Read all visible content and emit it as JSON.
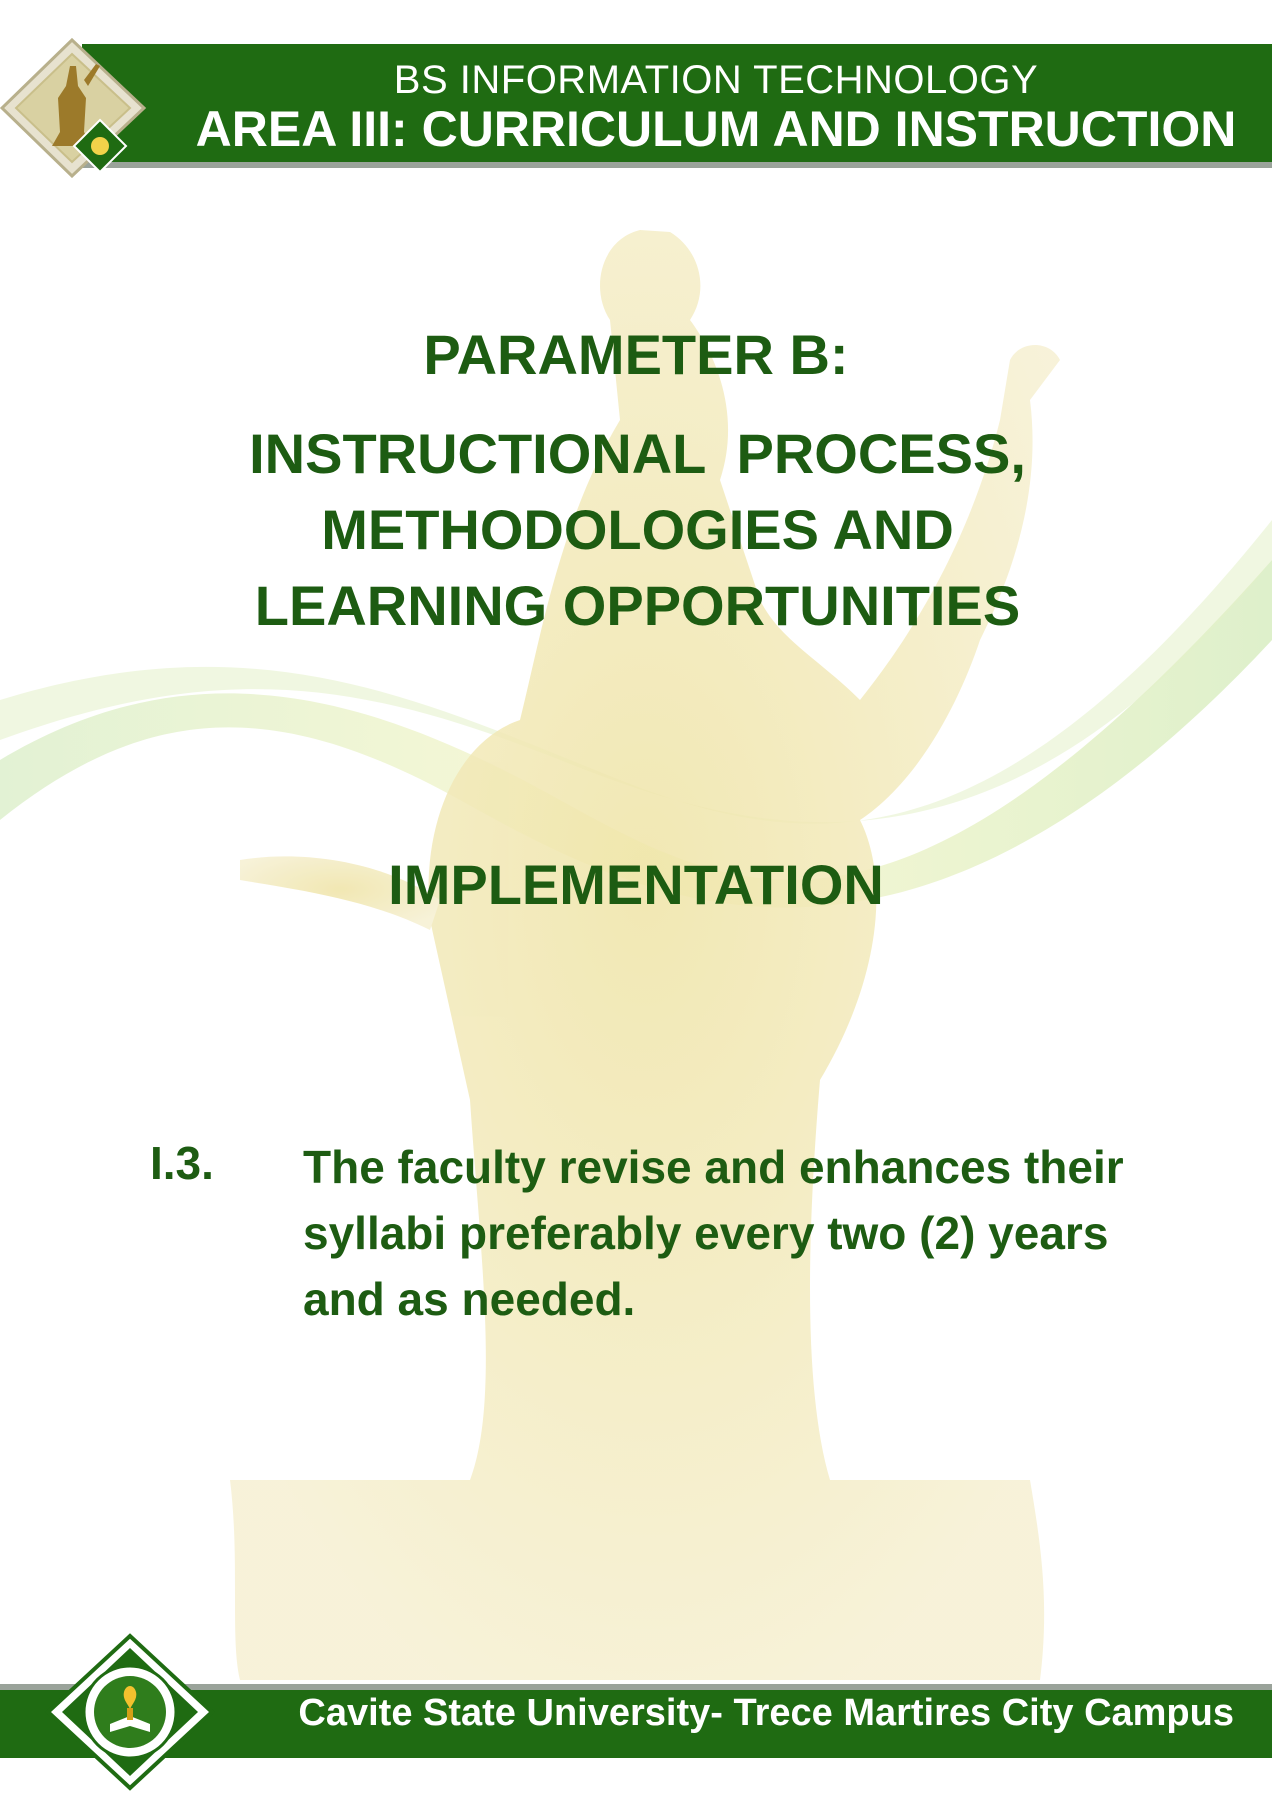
{
  "header": {
    "program": "BS INFORMATION TECHNOLOGY",
    "area": "AREA III: CURRICULUM AND INSTRUCTION"
  },
  "content": {
    "parameter_title": "PARAMETER B:",
    "parameter_subtitle": "INSTRUCTIONAL  PROCESS,\nMETHODOLOGIES AND\nLEARNING OPPORTUNITIES",
    "section": "IMPLEMENTATION",
    "item": {
      "number": "I.3.",
      "text": "The faculty revise and enhances their syllabi preferably every two (2) years and as needed."
    }
  },
  "footer": {
    "campus": "Cavite State University- Trece Martires City Campus"
  },
  "colors": {
    "brand_green": "#1f6b12",
    "text_green": "#1d5c12",
    "accent_gray": "#9aa39a"
  },
  "icons": {
    "header_emblem": "monument-emblem-icon",
    "footer_seal": "university-seal-icon"
  }
}
